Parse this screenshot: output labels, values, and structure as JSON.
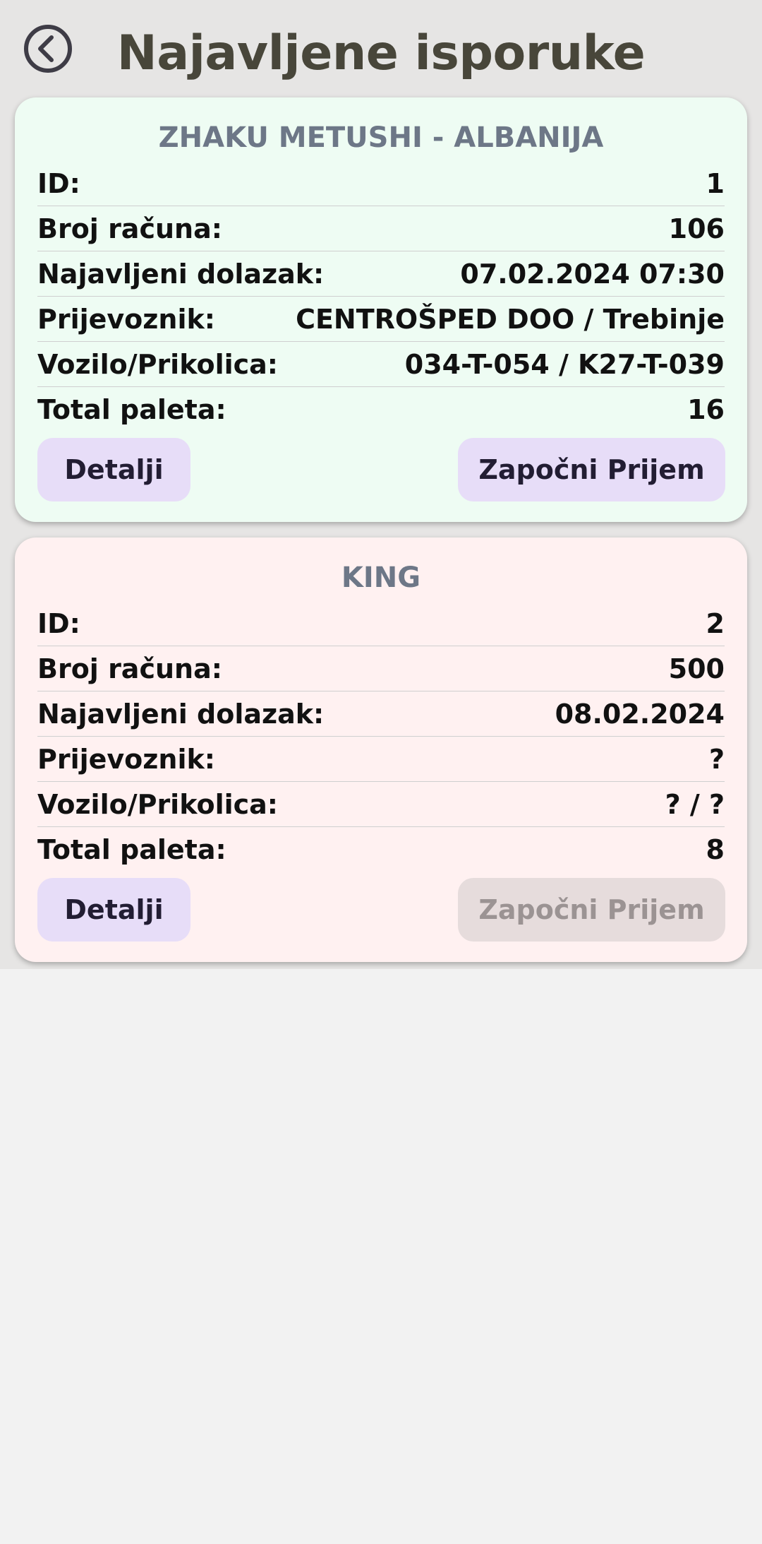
{
  "header": {
    "title": "Najavljene isporuke",
    "back_icon": "chevron-left-circle-icon"
  },
  "colors": {
    "title": "#48463a",
    "card_green_bg": "#eefcf3",
    "card_pink_bg": "#fff1f1",
    "card_title": "#6d7787",
    "button_bg": "#e7ddf8",
    "button_disabled_bg": "#e6dcdc"
  },
  "deliveries": [
    {
      "title": "ZHAKU METUSHI - ALBANIJA",
      "fields": [
        {
          "label": "ID:",
          "value": "1"
        },
        {
          "label": "Broj računa:",
          "value": "106"
        },
        {
          "label": "Najavljeni dolazak:",
          "value": "07.02.2024 07:30"
        },
        {
          "label": "Prijevoznik:",
          "value": "CENTROŠPED DOO / Trebinje"
        },
        {
          "label": "Vozilo/Prikolica:",
          "value": "034-T-054 / K27-T-039"
        },
        {
          "label": "Total paleta:",
          "value": "16"
        }
      ],
      "details_label": "Detalji",
      "start_label": "Započni Prijem",
      "start_enabled": true
    },
    {
      "title": "KING",
      "fields": [
        {
          "label": "ID:",
          "value": "2"
        },
        {
          "label": "Broj računa:",
          "value": "500"
        },
        {
          "label": "Najavljeni dolazak:",
          "value": "08.02.2024"
        },
        {
          "label": "Prijevoznik:",
          "value": "?"
        },
        {
          "label": "Vozilo/Prikolica:",
          "value": "? / ?"
        },
        {
          "label": "Total paleta:",
          "value": "8"
        }
      ],
      "details_label": "Detalji",
      "start_label": "Započni Prijem",
      "start_enabled": false
    }
  ]
}
